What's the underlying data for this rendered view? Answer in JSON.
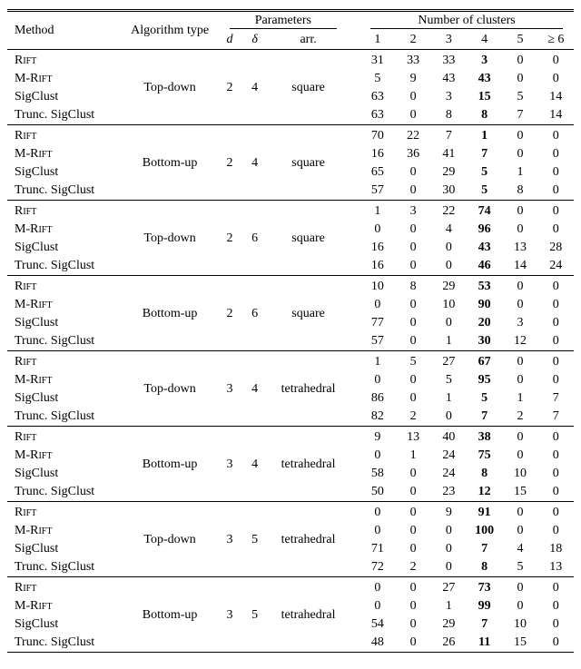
{
  "chart_data": {
    "type": "table",
    "title": "",
    "columns": [
      "Method",
      "Algorithm type",
      "d",
      "δ",
      "arr.",
      "1",
      "2",
      "3",
      "4",
      "5",
      "≥ 6"
    ],
    "groups": [
      {
        "alg": "Top-down",
        "d": 2,
        "delta": 4,
        "arr": "square",
        "rows": [
          {
            "method": "Rift",
            "c": [
              31,
              33,
              33,
              3,
              0,
              0
            ],
            "bold": 3
          },
          {
            "method": "M-Rift",
            "c": [
              5,
              9,
              43,
              43,
              0,
              0
            ],
            "bold": 3
          },
          {
            "method": "SigClust",
            "c": [
              63,
              0,
              3,
              15,
              5,
              14
            ],
            "bold": 3
          },
          {
            "method": "Trunc. SigClust",
            "c": [
              63,
              0,
              8,
              8,
              7,
              14
            ],
            "bold": 3
          }
        ]
      },
      {
        "alg": "Bottom-up",
        "d": 2,
        "delta": 4,
        "arr": "square",
        "rows": [
          {
            "method": "Rift",
            "c": [
              70,
              22,
              7,
              1,
              0,
              0
            ],
            "bold": 3
          },
          {
            "method": "M-Rift",
            "c": [
              16,
              36,
              41,
              7,
              0,
              0
            ],
            "bold": 3
          },
          {
            "method": "SigClust",
            "c": [
              65,
              0,
              29,
              5,
              1,
              0
            ],
            "bold": 3
          },
          {
            "method": "Trunc. SigClust",
            "c": [
              57,
              0,
              30,
              5,
              8,
              0
            ],
            "bold": 3
          }
        ]
      },
      {
        "alg": "Top-down",
        "d": 2,
        "delta": 6,
        "arr": "square",
        "rows": [
          {
            "method": "Rift",
            "c": [
              1,
              3,
              22,
              74,
              0,
              0
            ],
            "bold": 3
          },
          {
            "method": "M-Rift",
            "c": [
              0,
              0,
              4,
              96,
              0,
              0
            ],
            "bold": 3
          },
          {
            "method": "SigClust",
            "c": [
              16,
              0,
              0,
              43,
              13,
              28
            ],
            "bold": 3
          },
          {
            "method": "Trunc. SigClust",
            "c": [
              16,
              0,
              0,
              46,
              14,
              24
            ],
            "bold": 3
          }
        ]
      },
      {
        "alg": "Bottom-up",
        "d": 2,
        "delta": 6,
        "arr": "square",
        "rows": [
          {
            "method": "Rift",
            "c": [
              10,
              8,
              29,
              53,
              0,
              0
            ],
            "bold": 3
          },
          {
            "method": "M-Rift",
            "c": [
              0,
              0,
              10,
              90,
              0,
              0
            ],
            "bold": 3
          },
          {
            "method": "SigClust",
            "c": [
              77,
              0,
              0,
              20,
              3,
              0
            ],
            "bold": 3
          },
          {
            "method": "Trunc. SigClust",
            "c": [
              57,
              0,
              1,
              30,
              12,
              0
            ],
            "bold": 3
          }
        ]
      },
      {
        "alg": "Top-down",
        "d": 3,
        "delta": 4,
        "arr": "tetrahedral",
        "rows": [
          {
            "method": "Rift",
            "c": [
              1,
              5,
              27,
              67,
              0,
              0
            ],
            "bold": 3
          },
          {
            "method": "M-Rift",
            "c": [
              0,
              0,
              5,
              95,
              0,
              0
            ],
            "bold": 3
          },
          {
            "method": "SigClust",
            "c": [
              86,
              0,
              1,
              5,
              1,
              7
            ],
            "bold": 3
          },
          {
            "method": "Trunc. SigClust",
            "c": [
              82,
              2,
              0,
              7,
              2,
              7
            ],
            "bold": 3
          }
        ]
      },
      {
        "alg": "Bottom-up",
        "d": 3,
        "delta": 4,
        "arr": "tetrahedral",
        "rows": [
          {
            "method": "Rift",
            "c": [
              9,
              13,
              40,
              38,
              0,
              0
            ],
            "bold": 3
          },
          {
            "method": "M-Rift",
            "c": [
              0,
              1,
              24,
              75,
              0,
              0
            ],
            "bold": 3
          },
          {
            "method": "SigClust",
            "c": [
              58,
              0,
              24,
              8,
              10,
              0
            ],
            "bold": 3
          },
          {
            "method": "Trunc. SigClust",
            "c": [
              50,
              0,
              23,
              12,
              15,
              0
            ],
            "bold": 3
          }
        ]
      },
      {
        "alg": "Top-down",
        "d": 3,
        "delta": 5,
        "arr": "tetrahedral",
        "rows": [
          {
            "method": "Rift",
            "c": [
              0,
              0,
              9,
              91,
              0,
              0
            ],
            "bold": 3
          },
          {
            "method": "M-Rift",
            "c": [
              0,
              0,
              0,
              100,
              0,
              0
            ],
            "bold": 3
          },
          {
            "method": "SigClust",
            "c": [
              71,
              0,
              0,
              7,
              4,
              18
            ],
            "bold": 3
          },
          {
            "method": "Trunc. SigClust",
            "c": [
              72,
              2,
              0,
              8,
              5,
              13
            ],
            "bold": 3
          }
        ]
      },
      {
        "alg": "Bottom-up",
        "d": 3,
        "delta": 5,
        "arr": "tetrahedral",
        "rows": [
          {
            "method": "Rift",
            "c": [
              0,
              0,
              27,
              73,
              0,
              0
            ],
            "bold": 3
          },
          {
            "method": "M-Rift",
            "c": [
              0,
              0,
              1,
              99,
              0,
              0
            ],
            "bold": 3
          },
          {
            "method": "SigClust",
            "c": [
              54,
              0,
              29,
              7,
              10,
              0
            ],
            "bold": 3
          },
          {
            "method": "Trunc. SigClust",
            "c": [
              48,
              0,
              26,
              11,
              15,
              0
            ],
            "bold": 3
          }
        ]
      }
    ]
  },
  "headers": {
    "method": "Method",
    "alg": "Algorithm type",
    "params": "Parameters",
    "d": "d",
    "delta": "δ",
    "arr": "arr.",
    "nclust": "Number of clusters",
    "c1": "1",
    "c2": "2",
    "c3": "3",
    "c4": "4",
    "c5": "5",
    "c6": "≥ 6"
  },
  "methods_smallcaps": {
    "Rift": true,
    "M-Rift": true
  }
}
